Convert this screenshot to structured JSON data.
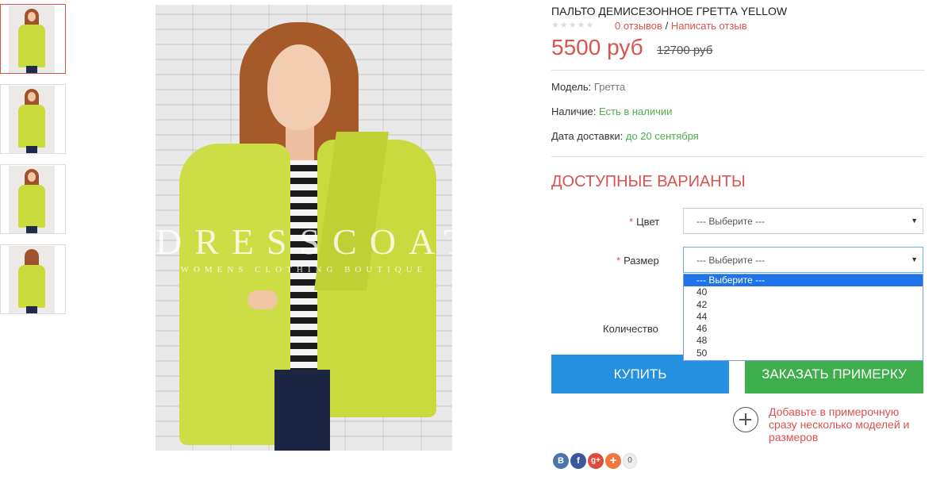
{
  "gallery": {
    "thumbs": [
      {
        "alt": "thumb-1",
        "active": true
      },
      {
        "alt": "thumb-2",
        "active": false
      },
      {
        "alt": "thumb-3",
        "active": false
      },
      {
        "alt": "thumb-4",
        "active": false
      }
    ],
    "watermark_title": "DRESSCOAT",
    "watermark_subtitle": "WOMENS CLOTHING BOUTIQUE"
  },
  "product": {
    "title": "ПАЛЬТО ДЕМИСЕЗОННОЕ ГРЕТТА YELLOW",
    "reviews_link": "0 отзывов",
    "separator": "/",
    "write_review_link": "Написать отзыв",
    "price": "5500 руб",
    "old_price": "12700 руб",
    "model_label": "Модель:",
    "model_value": "Гретта",
    "availability_label": "Наличие:",
    "availability_value": "Есть в наличии",
    "delivery_label": "Дата доставки:",
    "delivery_value": "до 20 сентября"
  },
  "options": {
    "heading": "ДОСТУПНЫЕ ВАРИАНТЫ",
    "required_mark": "*",
    "color_label": "Цвет",
    "color_value": "--- Выберите ---",
    "size_label": "Размер",
    "size_value": "--- Выберите ---",
    "size_options": [
      "--- Выберите ---",
      "40",
      "42",
      "44",
      "46",
      "48",
      "50"
    ],
    "quantity_label": "Количество"
  },
  "actions": {
    "buy_label": "КУПИТЬ",
    "fitting_label": "ЗАКАЗАТЬ ПРИМЕРКУ",
    "fitting_note": "Добавьте в примерочную сразу несколько моделей и размеров"
  },
  "share": {
    "vk": "В",
    "fb": "f",
    "gplus": "g+",
    "more": "+",
    "count": "0"
  },
  "colors": {
    "accent_red": "#d9534f",
    "buy_blue": "#2590e0",
    "fitting_green": "#3ead4c",
    "in_stock_green": "#4cae4c"
  }
}
